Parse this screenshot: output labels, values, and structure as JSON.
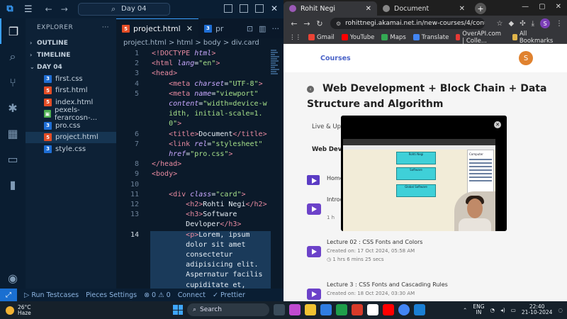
{
  "vscode": {
    "search_text": "Day 04",
    "sidebar": {
      "title": "EXPLORER",
      "more": "···",
      "sections": [
        "OUTLINE",
        "TIMELINE",
        "DAY 04"
      ],
      "files": [
        {
          "name": "first.css",
          "type": "css"
        },
        {
          "name": "first.html",
          "type": "html"
        },
        {
          "name": "index.html",
          "type": "html"
        },
        {
          "name": "pexels-ferarcosn-...",
          "type": "img"
        },
        {
          "name": "pro.css",
          "type": "css"
        },
        {
          "name": "project.html",
          "type": "html",
          "selected": true
        },
        {
          "name": "style.css",
          "type": "css"
        }
      ]
    },
    "tabs": [
      {
        "label": "project.html",
        "active": true,
        "icon": "html"
      },
      {
        "label": "pr",
        "active": false,
        "icon": "css"
      }
    ],
    "breadcrumb": "project.html  >  html  >  body  >  div.card",
    "code_lines": [
      {
        "n": "1",
        "html": "<span class='t-tag'>&lt;!DOCTYPE</span> <span class='t-attr'>html</span><span class='t-tag'>&gt;</span>"
      },
      {
        "n": "2",
        "html": "<span class='t-tag'>&lt;html</span> <span class='t-attr'>lang</span>=<span class='t-str'>\"en\"</span><span class='t-tag'>&gt;</span>"
      },
      {
        "n": "3",
        "html": "<span class='t-tag'>&lt;head&gt;</span>"
      },
      {
        "n": "4",
        "html": "    <span class='t-tag'>&lt;meta</span> <span class='t-attr'>charset</span>=<span class='t-str'>\"UTF-8\"</span><span class='t-tag'>&gt;</span>"
      },
      {
        "n": "5",
        "html": "    <span class='t-tag'>&lt;meta</span> <span class='t-attr'>name</span>=<span class='t-str'>\"viewport\"</span>"
      },
      {
        "n": "",
        "html": "    <span class='t-attr'>content</span>=<span class='t-str'>\"width=device-w</span>"
      },
      {
        "n": "",
        "html": "    <span class='t-str'>idth, initial-scale=1.</span>"
      },
      {
        "n": "",
        "html": "    <span class='t-str'>0\"</span><span class='t-tag'>&gt;</span>"
      },
      {
        "n": "6",
        "html": "    <span class='t-tag'>&lt;title&gt;</span><span class='t-txt'>Document</span><span class='t-tag'>&lt;/title&gt;</span>"
      },
      {
        "n": "7",
        "html": "    <span class='t-tag'>&lt;link</span> <span class='t-attr'>rel</span>=<span class='t-str'>\"stylesheet\"</span>"
      },
      {
        "n": "",
        "html": "    <span class='t-attr'>href</span>=<span class='t-str'>\"pro.css\"</span><span class='t-tag'>&gt;</span>"
      },
      {
        "n": "8",
        "html": "<span class='t-tag'>&lt;/head&gt;</span>"
      },
      {
        "n": "9",
        "html": "<span class='t-tag'>&lt;body&gt;</span>"
      },
      {
        "n": "10",
        "html": ""
      },
      {
        "n": "11",
        "html": "    <span class='t-tag'>&lt;div</span> <span class='t-attr'>class</span>=<span class='t-str'>\"card\"</span><span class='t-tag'>&gt;</span>"
      },
      {
        "n": "12",
        "html": "        <span class='t-tag'>&lt;h2&gt;</span><span class='t-txt'>Rohti Negi</span><span class='t-tag'>&lt;/h2&gt;</span>"
      },
      {
        "n": "13",
        "html": "        <span class='t-tag'>&lt;h3&gt;</span><span class='t-txt'>Software</span>"
      },
      {
        "n": "",
        "html": "        <span class='t-txt'>Devloper</span><span class='t-tag'>&lt;/h3&gt;</span>"
      },
      {
        "n": "14",
        "html": "        <span class='t-tag'>&lt;p&gt;</span><span class='t-txt'>Lorem, ipsum</span>",
        "current": true
      },
      {
        "n": "",
        "html": "        <span class='t-txt'>dolor sit amet</span>"
      },
      {
        "n": "",
        "html": "        <span class='t-txt'>consectetur</span>"
      },
      {
        "n": "",
        "html": "        <span class='t-txt'>adipisicing elit.</span>"
      },
      {
        "n": "",
        "html": "        <span class='t-txt'>Aspernatur facilis</span>"
      },
      {
        "n": "",
        "html": "        <span class='t-txt'>cupiditate et,</span>"
      }
    ],
    "status": {
      "testcases": "▷ Run Testcases",
      "pieces": "Pieces Settings",
      "problems": "⊗ 0  ⚠ 0",
      "connect": "Connect",
      "prettier": "✓ Prettier"
    }
  },
  "chrome": {
    "tabs": [
      {
        "label": "Rohit Negi",
        "active": true
      },
      {
        "label": "Document",
        "active": false
      }
    ],
    "url": "rohittnegi.akamai.net.in/new-courses/4/content?a...",
    "bookmarks": [
      "Gmail",
      "YouTube",
      "Maps",
      "Translate",
      "OverAPI.com | Colle..."
    ],
    "all_bookmarks": "All Bookmarks",
    "profile_initial": "S",
    "page": {
      "nav_courses": "Courses",
      "avatar_initial": "S",
      "course_title": "Web Development + Block Chain + Data Structure and Algorithm",
      "tabs": [
        "Live & Upco"
      ],
      "subtab": "Web Develo",
      "home_label": "Home",
      "intro_label": "Introd",
      "intro_sub": "1 h",
      "lectures": [
        {
          "title": "Lecture 02 : CSS Fonts and Colors",
          "created": "Created on: 17 Oct 2024, 05:58 AM",
          "duration": "1 hrs 6 mins 25 secs"
        },
        {
          "title": "Lecture 3 : CSS Fonts and Cascading Rules",
          "created": "Created on: 18 Oct 2024, 03:30 AM",
          "duration": ""
        }
      ]
    }
  },
  "video_overlay": {
    "boxes": [
      "Rohti Negi",
      "Software",
      "Global Software"
    ],
    "computer_label": "Computer"
  },
  "taskbar": {
    "temperature": "26°C",
    "weather": "Haze",
    "search_placeholder": "Search",
    "lang_top": "ENG",
    "lang_bottom": "IN",
    "time": "22:40",
    "date": "21-10-2024"
  }
}
